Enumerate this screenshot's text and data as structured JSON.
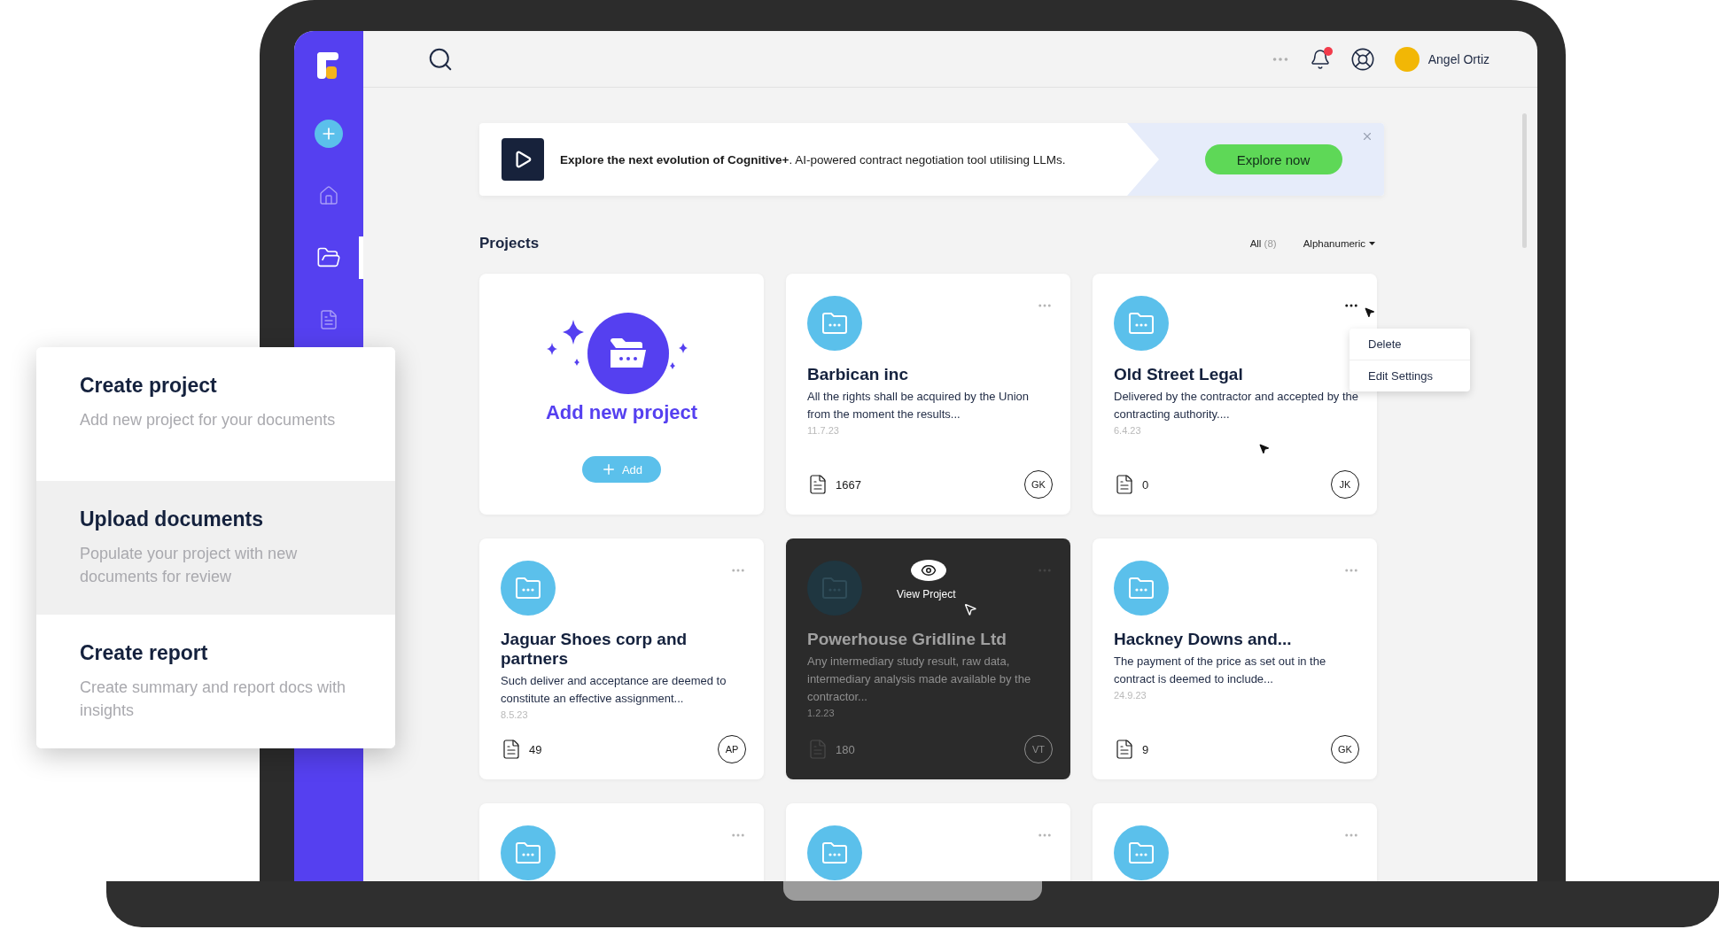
{
  "sidebar": {
    "items": [
      {
        "kind": "add",
        "selected": false
      },
      {
        "kind": "home",
        "selected": false
      },
      {
        "kind": "projects",
        "selected": true
      },
      {
        "kind": "documents",
        "selected": false
      }
    ]
  },
  "topbar": {
    "user_name": "Angel Ortiz",
    "notifications_unread": true
  },
  "banner": {
    "text": "**Explore the next evolution of Cognitive+**. AI-powered contract negotiation tool utilising LLMs.",
    "button": "Explore now"
  },
  "projects": {
    "title": "Projects",
    "filter": "All",
    "filter_count": "(8)",
    "sort": "Alphanumeric"
  },
  "cards": [
    {
      "kind": "add",
      "title": "Add new project",
      "button": "Add"
    },
    {
      "kind": "project",
      "name": "Barbican inc",
      "description": "All the rights shall be acquired by the Union from the moment the results...",
      "date": "11.7.23",
      "documents": "1667",
      "owner": "GK",
      "hovered": false,
      "menu_open": false
    },
    {
      "kind": "project",
      "name": "Old Street Legal",
      "description": "Delivered by the contractor and accepted by the contracting authority....",
      "date": "6.4.23",
      "documents": "0",
      "owner": "JK",
      "hovered": false,
      "menu_open": true
    },
    {
      "kind": "project",
      "name": "Jaguar Shoes corp and partners",
      "description": "Such deliver and acceptance are deemed to constitute an effective assignment...",
      "date": "8.5.23",
      "documents": "49",
      "owner": "AP",
      "hovered": false,
      "menu_open": false
    },
    {
      "kind": "project",
      "name": "Powerhouse Gridline Ltd",
      "description": "Any intermediary study result, raw data, intermediary analysis made available by the contractor...",
      "date": "1.2.23",
      "documents": "180",
      "owner": "VT",
      "hovered": true,
      "menu_open": false
    },
    {
      "kind": "project",
      "name": "Hackney Downs and...",
      "description": "The payment of the price as set out in the contract is deemed to include...",
      "date": "24.9.23",
      "documents": "9",
      "owner": "GK",
      "hovered": false,
      "menu_open": false
    },
    {
      "kind": "project",
      "hovered": false,
      "menu_open": false
    },
    {
      "kind": "project",
      "hovered": false,
      "menu_open": false
    },
    {
      "kind": "project",
      "hovered": false,
      "menu_open": false
    }
  ],
  "card_menu": {
    "items": [
      "Delete",
      "Edit Settings"
    ]
  },
  "hover_label": "View Project",
  "steps": [
    {
      "title": "Create project",
      "description": "Add new project for your documents",
      "selected": false
    },
    {
      "title": "Upload documents",
      "description": "Populate your project with new documents for review",
      "selected": true
    },
    {
      "title": "Create report",
      "description": "Create summary and report docs with insights",
      "selected": false
    }
  ]
}
